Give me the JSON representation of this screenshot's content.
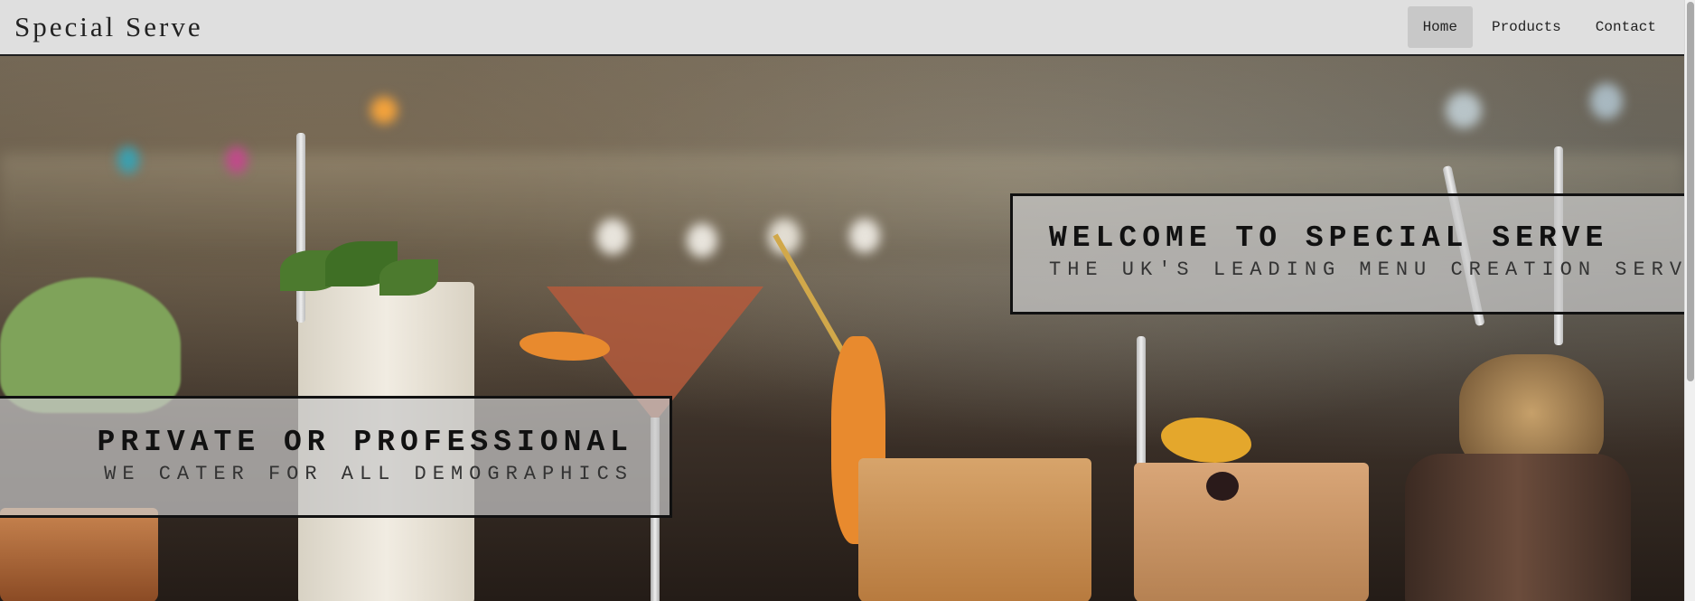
{
  "brand": "Special Serve",
  "nav": {
    "items": [
      {
        "label": "Home",
        "active": true
      },
      {
        "label": "Products",
        "active": false
      },
      {
        "label": "Contact",
        "active": false
      }
    ]
  },
  "hero": {
    "welcome": {
      "title": "WELCOME TO SPECIAL SERVE",
      "subtitle": "THE UK'S LEADING MENU CREATION SERVICE"
    },
    "private": {
      "title": "PRIVATE OR PROFESSIONAL",
      "subtitle": "WE CATER FOR ALL DEMOGRAPHICS"
    }
  },
  "colors": {
    "navbar_bg": "#dfdfdf",
    "nav_active_bg": "#c8c8c8",
    "panel_bg": "#c8c8c8",
    "panel_border": "#111111"
  }
}
